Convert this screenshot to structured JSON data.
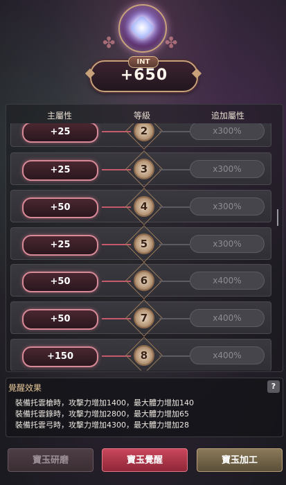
{
  "header": {
    "stat_tag": "INT",
    "stat_value": "+650"
  },
  "table": {
    "columns": [
      "主屬性",
      "等級",
      "追加屬性"
    ],
    "rows": [
      {
        "main": "+25",
        "level": "2",
        "bonus": "x300%"
      },
      {
        "main": "+25",
        "level": "3",
        "bonus": "x300%"
      },
      {
        "main": "+50",
        "level": "4",
        "bonus": "x300%"
      },
      {
        "main": "+25",
        "level": "5",
        "bonus": "x300%"
      },
      {
        "main": "+50",
        "level": "6",
        "bonus": "x400%"
      },
      {
        "main": "+50",
        "level": "7",
        "bonus": "x400%"
      },
      {
        "main": "+150",
        "level": "8",
        "bonus": "x400%"
      }
    ]
  },
  "effect": {
    "title": "覺醒效果",
    "help": "?",
    "lines": [
      "裝備托雲槍時，攻擊力增加1400，最大體力增加140",
      "裝備托雲錄時，攻擊力增加2800，最大體力增加65",
      "裝備托雲弓時，攻擊力增加4300，最大體力增加28"
    ]
  },
  "buttons": {
    "grind": "寶玉研磨",
    "awaken": "寶玉覺醒",
    "process": "寶玉加工"
  },
  "colors": {
    "accent_red": "#c9475b",
    "gold": "#caa27a",
    "pill_border": "#d98a98"
  }
}
